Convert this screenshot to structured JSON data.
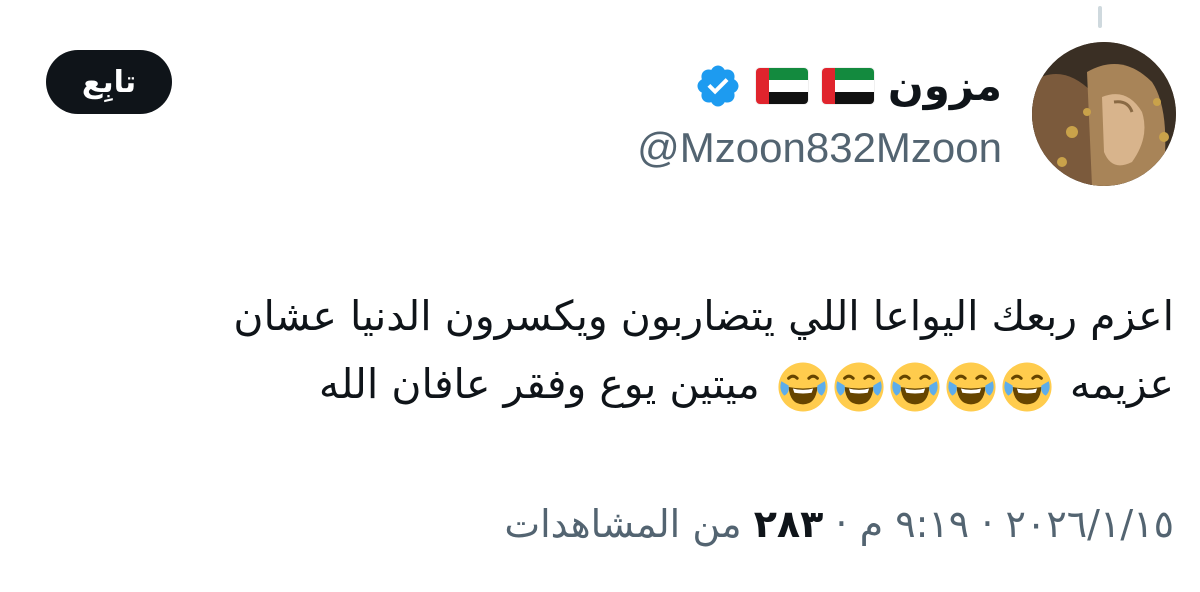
{
  "author": {
    "display_name": "مزون",
    "flag_emojis": [
      "flag-uae-icon",
      "flag-uae-icon"
    ],
    "verified": true,
    "handle": "@Mzoon832Mzoon"
  },
  "actions": {
    "follow_label": "تابِع"
  },
  "tweet": {
    "line1": "اعزم ربعك اليواعا اللي يتضاربون ويكسرون الدنيا عشان",
    "line2_start": "عزيمه",
    "line2_end": "ميتين يوع وفقر عافان الله",
    "emoji_count": 5,
    "emoji_icon": "face-with-tears-of-joy-icon"
  },
  "meta": {
    "date": "٢٠٢٦/١/١٥",
    "separator": "·",
    "time": "٩:١٩ م",
    "views_count": "٢٨٣",
    "views_label": "من المشاهدات"
  },
  "colors": {
    "verified_blue": "#1d9bf0",
    "text_primary": "#0f1419",
    "text_secondary": "#536471",
    "button_bg": "#0f1419"
  }
}
